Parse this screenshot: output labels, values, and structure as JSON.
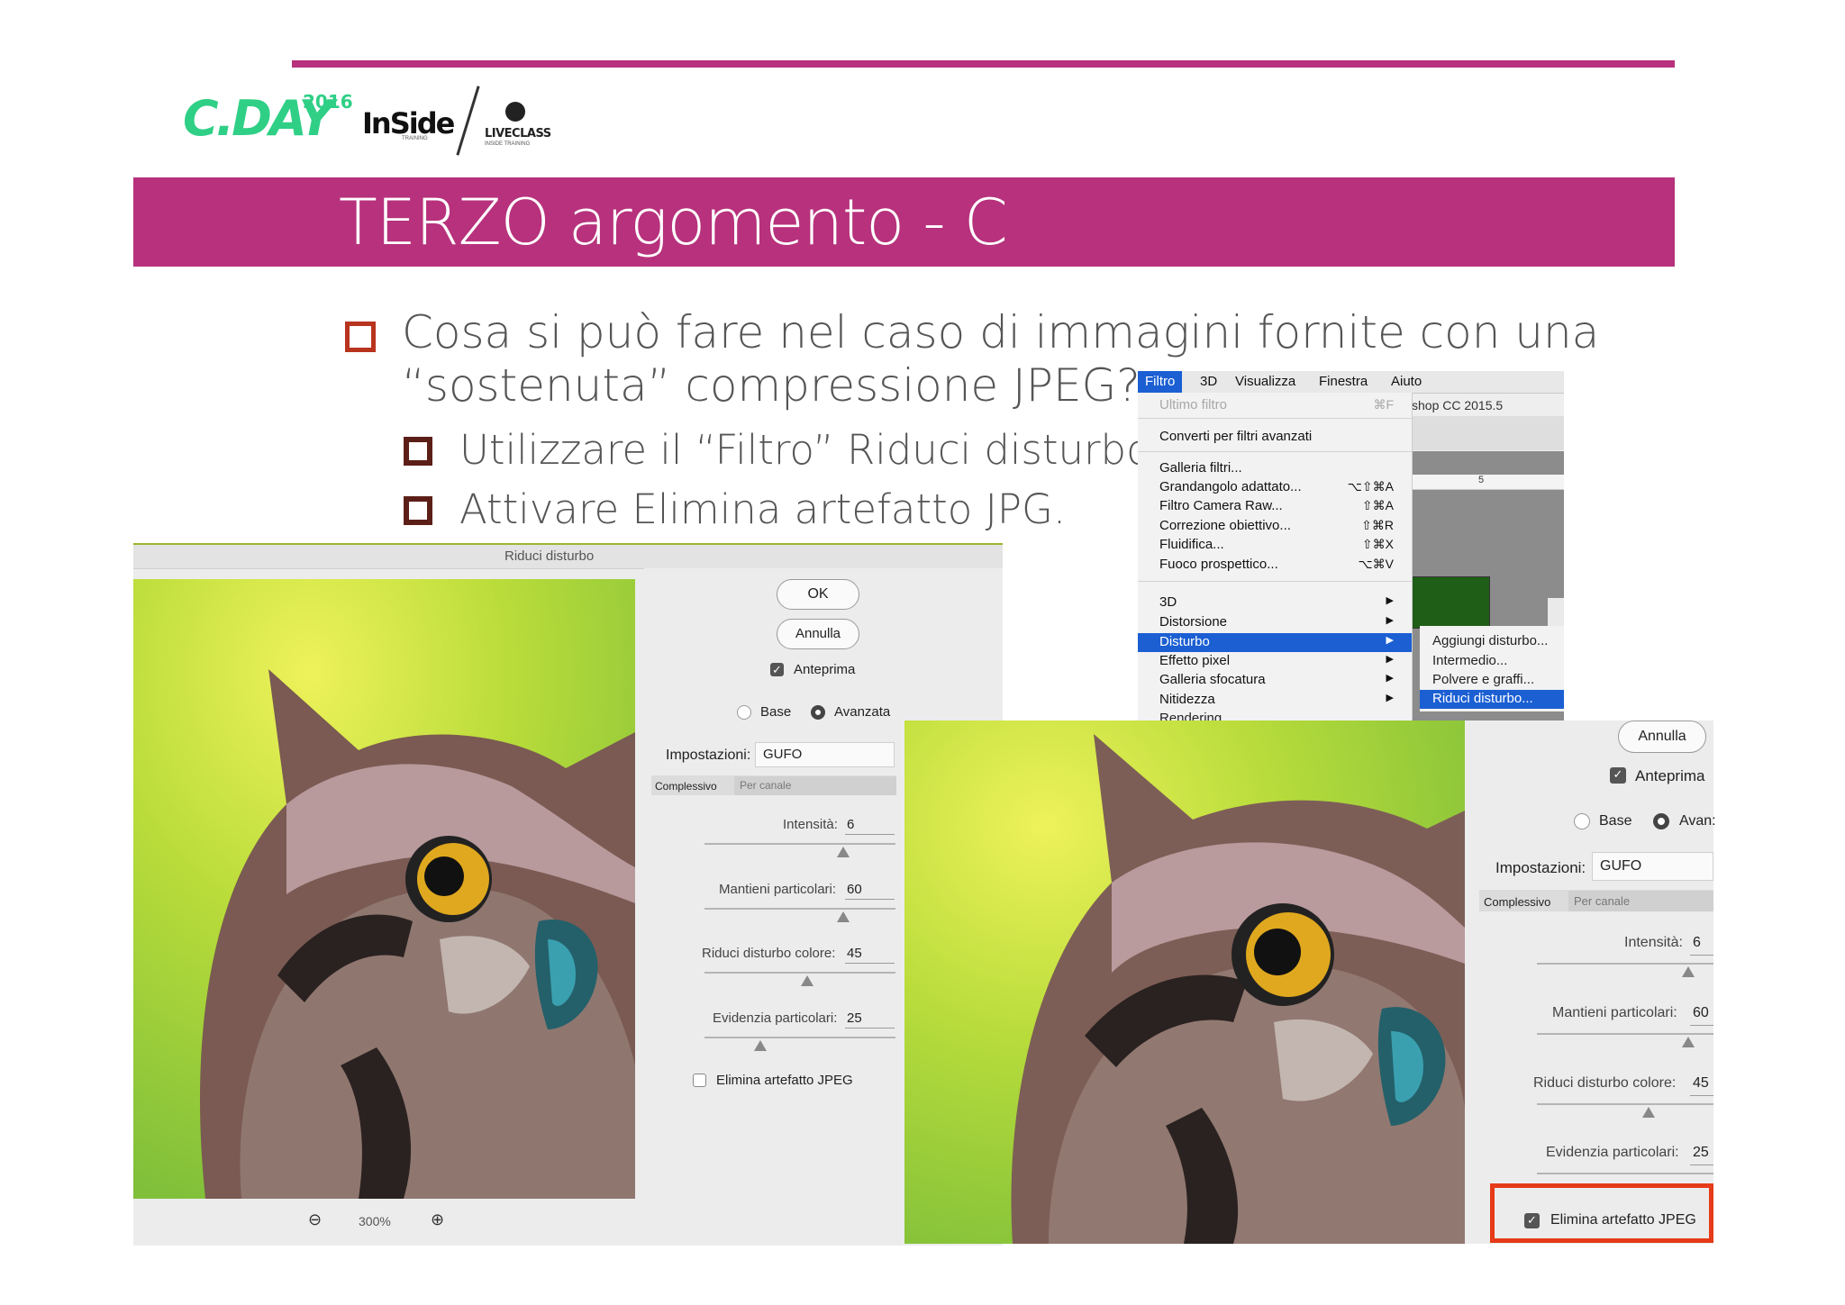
{
  "header": {
    "logo_cday": "C.DAY",
    "logo_cday_year": "2016",
    "logo_inside": "InSide",
    "logo_inside_sub": "TRAINING",
    "logo_liveclass": "LIVECLASS",
    "logo_liveclass_sub": "INSIDE TRAINING",
    "title": "TERZO argomento - C"
  },
  "bullets": {
    "main_line1": "Cosa si può fare nel caso di immagini fornite con una",
    "main_line2": "“sostenuta” compressione JPEG?",
    "sub1": "Utilizzare il “Filtro” Riduci disturbo",
    "sub2": "Attivare Elimina artefatto JPG."
  },
  "dialog_left": {
    "title": "Riduci disturbo",
    "ok_label": "OK",
    "cancel_label": "Annulla",
    "preview_label": "Anteprima",
    "preview_checked": true,
    "mode_basic": "Base",
    "mode_advanced": "Avanzata",
    "settings_label": "Impostazioni:",
    "settings_value": "GUFO",
    "tab_overall": "Complessivo",
    "tab_per_channel": "Per canale",
    "intensity_label": "Intensità:",
    "intensity_value": "6",
    "preserve_label": "Mantieni particolari:",
    "preserve_value": "60",
    "color_noise_label": "Riduci disturbo colore:",
    "color_noise_value": "45",
    "sharpen_label": "Evidenzia particolari:",
    "sharpen_value": "25",
    "jpeg_label": "Elimina artefatto JPEG",
    "jpeg_checked": false,
    "zoom_value": "300%"
  },
  "menu": {
    "bar": [
      "Filtro",
      "3D",
      "Visualizza",
      "Finestra",
      "Aiuto"
    ],
    "app_title_fragment": "shop CC 2015.5",
    "ruler_mark": "5",
    "items": [
      {
        "label": "Ultimo filtro",
        "shortcut": "⌘F",
        "disabled": true
      },
      {
        "label": "Converti per filtri avanzati",
        "shortcut": ""
      },
      {
        "label": "Galleria filtri...",
        "shortcut": ""
      },
      {
        "label": "Grandangolo adattato...",
        "shortcut": "⌥⇧⌘A"
      },
      {
        "label": "Filtro Camera Raw...",
        "shortcut": "⇧⌘A"
      },
      {
        "label": "Correzione obiettivo...",
        "shortcut": "⇧⌘R"
      },
      {
        "label": "Fluidifica...",
        "shortcut": "⇧⌘X"
      },
      {
        "label": "Fuoco prospettico...",
        "shortcut": "⌥⌘V"
      },
      {
        "label": "3D",
        "shortcut": "▶"
      },
      {
        "label": "Distorsione",
        "shortcut": "▶"
      },
      {
        "label": "Disturbo",
        "shortcut": "▶",
        "highlighted": true
      },
      {
        "label": "Effetto pixel",
        "shortcut": "▶"
      },
      {
        "label": "Galleria sfocatura",
        "shortcut": "▶"
      },
      {
        "label": "Nitidezza",
        "shortcut": "▶"
      },
      {
        "label": "Rendering",
        "shortcut": "▶"
      }
    ],
    "submenu": [
      "Aggiungi disturbo...",
      "Intermedio...",
      "Polvere e graffi...",
      "Riduci disturbo..."
    ],
    "submenu_highlighted": 3
  },
  "dialog_right": {
    "cancel_label": "Annulla",
    "preview_label": "Anteprima",
    "preview_checked": true,
    "mode_basic": "Base",
    "mode_advanced": "Avan:",
    "settings_label": "Impostazioni:",
    "settings_value": "GUFO",
    "tab_overall": "Complessivo",
    "tab_per_channel": "Per canale",
    "intensity_label": "Intensità:",
    "intensity_value": "6",
    "preserve_label": "Mantieni particolari:",
    "preserve_value": "60",
    "color_noise_label": "Riduci disturbo colore:",
    "color_noise_value": "45",
    "sharpen_label": "Evidenzia particolari:",
    "sharpen_value": "25",
    "jpeg_label": "Elimina artefatto JPEG",
    "jpeg_checked": true
  },
  "colors": {
    "brand": "#b7317c",
    "bullet": "#b8341f",
    "menu_highlight": "#1b5fd3",
    "callout": "#e63a18"
  }
}
